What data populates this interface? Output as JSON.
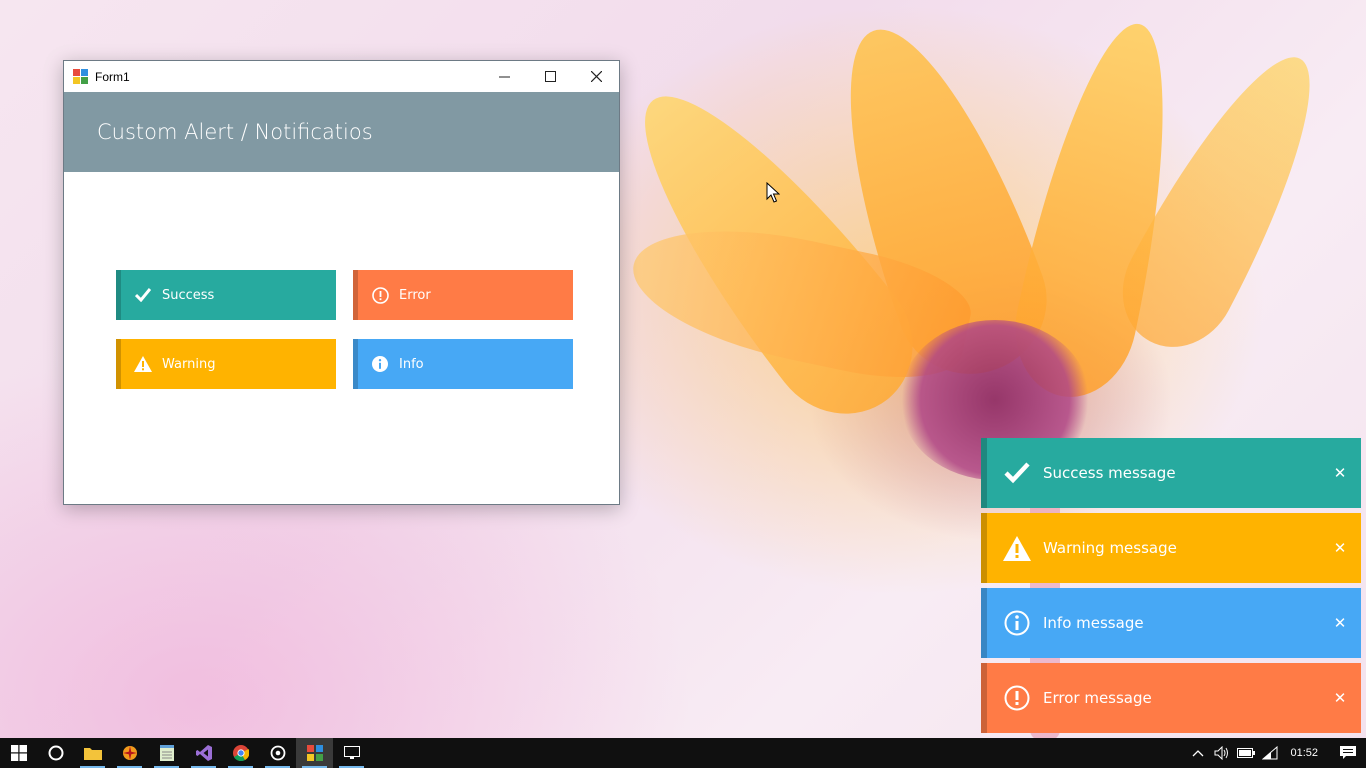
{
  "window": {
    "title": "Form1",
    "minimize_icon": "minimize-icon",
    "maximize_icon": "maximize-icon",
    "close_icon": "close-icon",
    "header_title": "Custom Alert / Notificatios",
    "header_color": "#8199a3"
  },
  "buttons": {
    "success": {
      "label": "Success",
      "icon": "check-icon",
      "color": "#27aa9f"
    },
    "error": {
      "label": "Error",
      "icon": "exclamation-circle-icon",
      "color": "#ff7b46"
    },
    "warning": {
      "label": "Warning",
      "icon": "warning-triangle-icon",
      "color": "#ffb300"
    },
    "info": {
      "label": "Info",
      "icon": "info-circle-icon",
      "color": "#47a8f5"
    }
  },
  "toasts": [
    {
      "message": "Success message",
      "icon": "check-icon",
      "color": "#27aa9f",
      "close": "✕"
    },
    {
      "message": "Warning message",
      "icon": "warning-triangle-icon",
      "color": "#ffb300",
      "close": "✕"
    },
    {
      "message": "Info message",
      "icon": "info-circle-icon",
      "color": "#47a8f5",
      "close": "✕"
    },
    {
      "message": "Error message",
      "icon": "exclamation-circle-icon",
      "color": "#ff7b46",
      "close": "✕"
    }
  ],
  "taskbar": {
    "apps": [
      "windows-start-icon",
      "cortana-icon",
      "file-explorer-icon",
      "app-orange-icon",
      "notepad-icon",
      "visual-studio-icon",
      "chrome-icon",
      "media-icon",
      "form1-app-icon",
      "desktop-icon"
    ],
    "clock": "01:52"
  }
}
